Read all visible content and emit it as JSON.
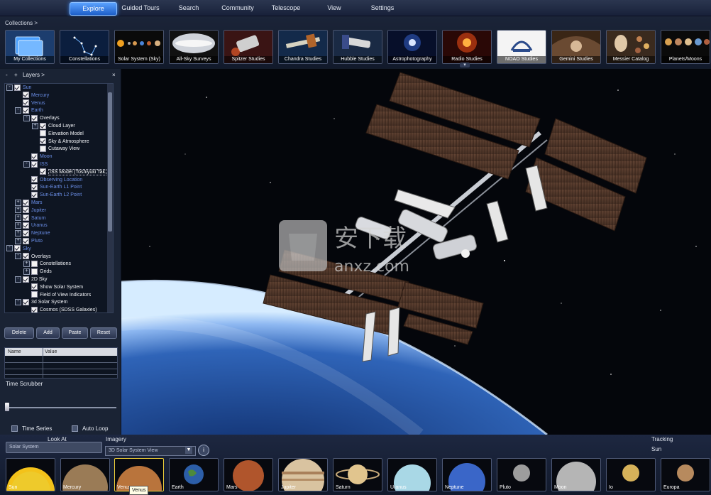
{
  "menu": {
    "items": [
      "Explore",
      "Guided Tours",
      "Search",
      "Community",
      "Telescope",
      "View",
      "Settings"
    ],
    "active": "Explore"
  },
  "collections": {
    "label": "Collections  >",
    "items": [
      "My Collections",
      "Constellations",
      "Solar System (Sky)",
      "All-Sky Surveys",
      "Spitzer Studies",
      "Chandra Studies",
      "Hubble Studies",
      "Astrophotography",
      "Radio Studies",
      "NOAO Studies",
      "Gemini Studies",
      "Messier Catalog",
      "Planets/Moons"
    ],
    "collapse_icon": "chevron-down"
  },
  "layers": {
    "title": "Layers  >",
    "minus": "-",
    "plus": "+",
    "close": "×",
    "tree": [
      {
        "label": "Sun",
        "depth": 0,
        "expander": "-",
        "checked": true,
        "color": "blue"
      },
      {
        "label": "Mercury",
        "depth": 1,
        "expander": "",
        "checked": true,
        "color": "blue"
      },
      {
        "label": "Venus",
        "depth": 1,
        "expander": "",
        "checked": true,
        "color": "blue"
      },
      {
        "label": "Earth",
        "depth": 1,
        "expander": "-",
        "checked": true,
        "color": "blue"
      },
      {
        "label": "Overlays",
        "depth": 2,
        "expander": "-",
        "checked": true,
        "color": "white"
      },
      {
        "label": "Cloud Layer",
        "depth": 3,
        "expander": "+",
        "checked": true,
        "color": "white"
      },
      {
        "label": "Elevation Model",
        "depth": 3,
        "expander": "",
        "checked": false,
        "color": "white"
      },
      {
        "label": "Sky & Atmosphere",
        "depth": 3,
        "expander": "",
        "checked": true,
        "color": "white"
      },
      {
        "label": "Cutaway View",
        "depth": 3,
        "expander": "",
        "checked": false,
        "color": "white"
      },
      {
        "label": "Moon",
        "depth": 2,
        "expander": "",
        "checked": true,
        "color": "blue"
      },
      {
        "label": "ISS",
        "depth": 2,
        "expander": "-",
        "checked": true,
        "color": "blue"
      },
      {
        "label": "ISS Model  (Toshiyuki Tak",
        "depth": 3,
        "expander": "",
        "checked": true,
        "color": "white",
        "selected": true
      },
      {
        "label": "Observing Location",
        "depth": 2,
        "expander": "",
        "checked": true,
        "color": "blue"
      },
      {
        "label": "Sun-Earth L1 Point",
        "depth": 2,
        "expander": "",
        "checked": true,
        "color": "blue"
      },
      {
        "label": "Sun-Earth L2 Point",
        "depth": 2,
        "expander": "",
        "checked": true,
        "color": "blue"
      },
      {
        "label": "Mars",
        "depth": 1,
        "expander": "+",
        "checked": true,
        "color": "blue"
      },
      {
        "label": "Jupiter",
        "depth": 1,
        "expander": "+",
        "checked": true,
        "color": "blue"
      },
      {
        "label": "Saturn",
        "depth": 1,
        "expander": "+",
        "checked": true,
        "color": "blue"
      },
      {
        "label": "Uranus",
        "depth": 1,
        "expander": "+",
        "checked": true,
        "color": "blue"
      },
      {
        "label": "Neptune",
        "depth": 1,
        "expander": "+",
        "checked": true,
        "color": "blue"
      },
      {
        "label": "Pluto",
        "depth": 1,
        "expander": "+",
        "checked": true,
        "color": "blue"
      },
      {
        "label": "Sky",
        "depth": 0,
        "expander": "-",
        "checked": true,
        "color": "blue"
      },
      {
        "label": "Overlays",
        "depth": 1,
        "expander": "-",
        "checked": true,
        "color": "white"
      },
      {
        "label": "Constellations",
        "depth": 2,
        "expander": "+",
        "checked": false,
        "color": "white"
      },
      {
        "label": "Grids",
        "depth": 2,
        "expander": "+",
        "checked": false,
        "color": "white"
      },
      {
        "label": "2D Sky",
        "depth": 1,
        "expander": "-",
        "checked": true,
        "color": "white"
      },
      {
        "label": "Show Solar System",
        "depth": 2,
        "expander": "",
        "checked": true,
        "color": "white"
      },
      {
        "label": "Field of View Indicators",
        "depth": 2,
        "expander": "",
        "checked": false,
        "color": "white"
      },
      {
        "label": "3d Solar System",
        "depth": 1,
        "expander": "-",
        "checked": true,
        "color": "white"
      },
      {
        "label": "Cosmos (SDSS Galaxies)",
        "depth": 2,
        "expander": "",
        "checked": true,
        "color": "white"
      }
    ],
    "buttons": [
      "Delete",
      "Add",
      "Paste",
      "Reset"
    ]
  },
  "properties": {
    "col_name": "Name",
    "col_value": "Value"
  },
  "time": {
    "label": "Time Scrubber",
    "position": 0.02
  },
  "bottom": {
    "time_series": "Time Series",
    "auto_loop": "Auto Loop",
    "look_at_label": "Look At",
    "look_at_value": "Solar System",
    "imagery_label": "Imagery",
    "imagery_value": "3D Solar System View",
    "tracking_label": "Tracking",
    "tracking_value": "Sun",
    "info_icon": "i",
    "tooltip": "Venus",
    "planets": [
      "Sun",
      "Mercury",
      "Venus",
      "Earth",
      "Mars",
      "Jupiter",
      "Saturn",
      "Uranus",
      "Neptune",
      "Pluto",
      "Moon",
      "Io",
      "Europa"
    ],
    "active_planet": "Venus"
  },
  "watermark": {
    "text_cn": "安下载",
    "text_en": "anxz.com"
  },
  "colors": {
    "accent": "#3c8cff",
    "tree_blue": "#6b8fe8",
    "active_outline": "#f0d03a"
  }
}
